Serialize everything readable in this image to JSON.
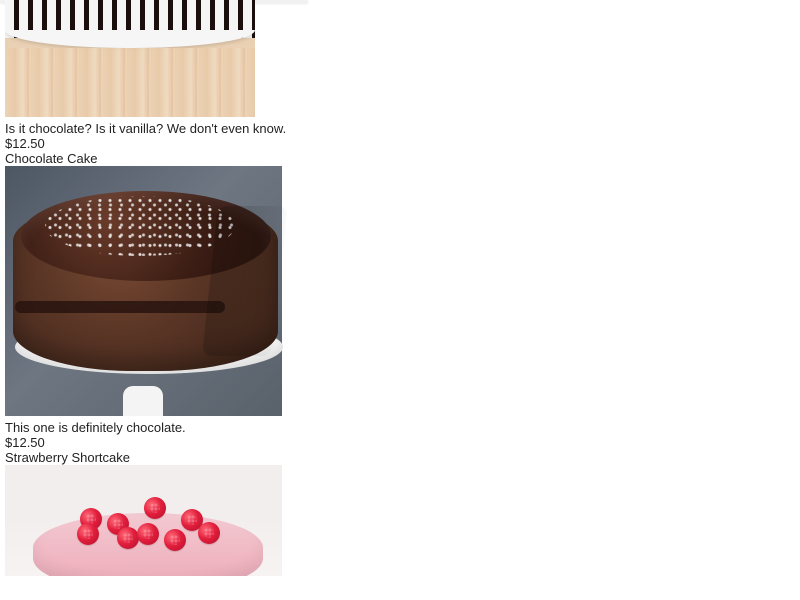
{
  "products": [
    {
      "description": "Is it chocolate? Is it vanilla? We don't even know.",
      "price": "$12.50"
    },
    {
      "name": "Chocolate Cake",
      "description": "This one is definitely chocolate.",
      "price": "$12.50"
    },
    {
      "name": "Strawberry Shortcake"
    }
  ]
}
